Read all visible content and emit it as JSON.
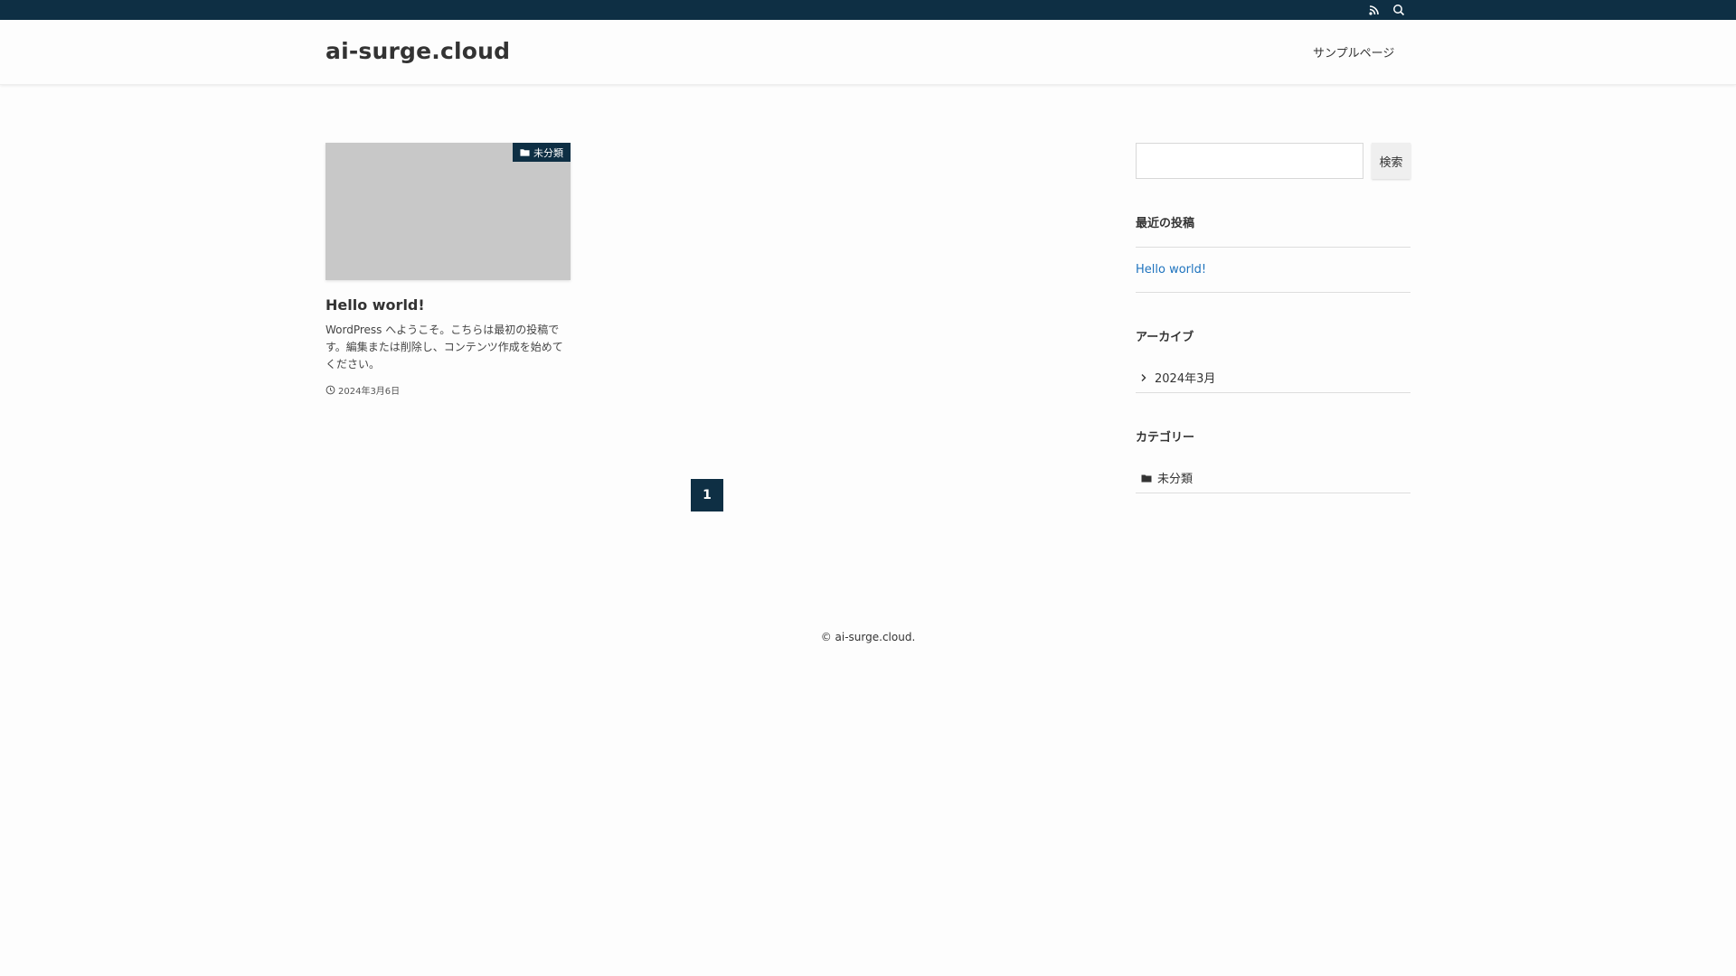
{
  "topbar": {
    "bg_color": "#0e2f44",
    "icons": [
      "rss-icon",
      "search-icon"
    ]
  },
  "header": {
    "site_title": "ai-surge.cloud",
    "nav": [
      {
        "label": "サンプルページ"
      }
    ]
  },
  "posts": [
    {
      "title": "Hello world!",
      "category": "未分類",
      "excerpt": "WordPress へようこそ。こちらは最初の投稿です。編集または削除し、コンテンツ作成を始めてください。",
      "date": "2024年3月6日"
    }
  ],
  "pagination": {
    "current": "1"
  },
  "sidebar": {
    "search": {
      "placeholder": "",
      "button_label": "検索"
    },
    "recent_posts": {
      "title": "最近の投稿",
      "items": [
        "Hello world!"
      ]
    },
    "archives": {
      "title": "アーカイブ",
      "items": [
        "2024年3月"
      ]
    },
    "categories": {
      "title": "カテゴリー",
      "items": [
        "未分類"
      ]
    }
  },
  "footer": {
    "copyright": "© ai-surge.cloud."
  },
  "colors": {
    "accent_dark": "#0e2f44",
    "link_blue": "#1e73be",
    "thumb_gray": "#c8c8c8"
  }
}
